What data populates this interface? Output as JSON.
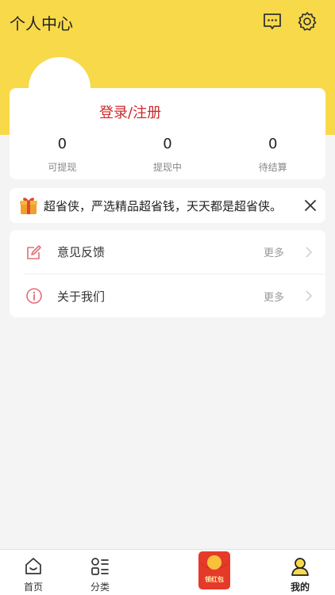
{
  "header": {
    "title": "个人中心",
    "background_color": "#f8d94a",
    "icons": [
      "message-icon",
      "settings-icon"
    ]
  },
  "profile": {
    "login_label": "登录/注册",
    "login_color": "#d0282a",
    "stats": [
      {
        "value": "0",
        "label": "可提现"
      },
      {
        "value": "0",
        "label": "提现中"
      },
      {
        "value": "0",
        "label": "待结算"
      }
    ]
  },
  "notice": {
    "text": "超省侠，严选精品超省钱，天天都是超省侠。",
    "icon": "gift-icon"
  },
  "menu": [
    {
      "label": "意见反馈",
      "more": "更多",
      "icon": "feedback-icon"
    },
    {
      "label": "关于我们",
      "more": "更多",
      "icon": "info-icon"
    }
  ],
  "tabbar": {
    "items": [
      {
        "label": "首页",
        "icon": "home-icon"
      },
      {
        "label": "分类",
        "icon": "category-icon"
      },
      {
        "label": "领红包",
        "icon": "red-packet-icon"
      },
      {
        "label": "我的",
        "icon": "profile-icon",
        "active": true
      }
    ]
  }
}
